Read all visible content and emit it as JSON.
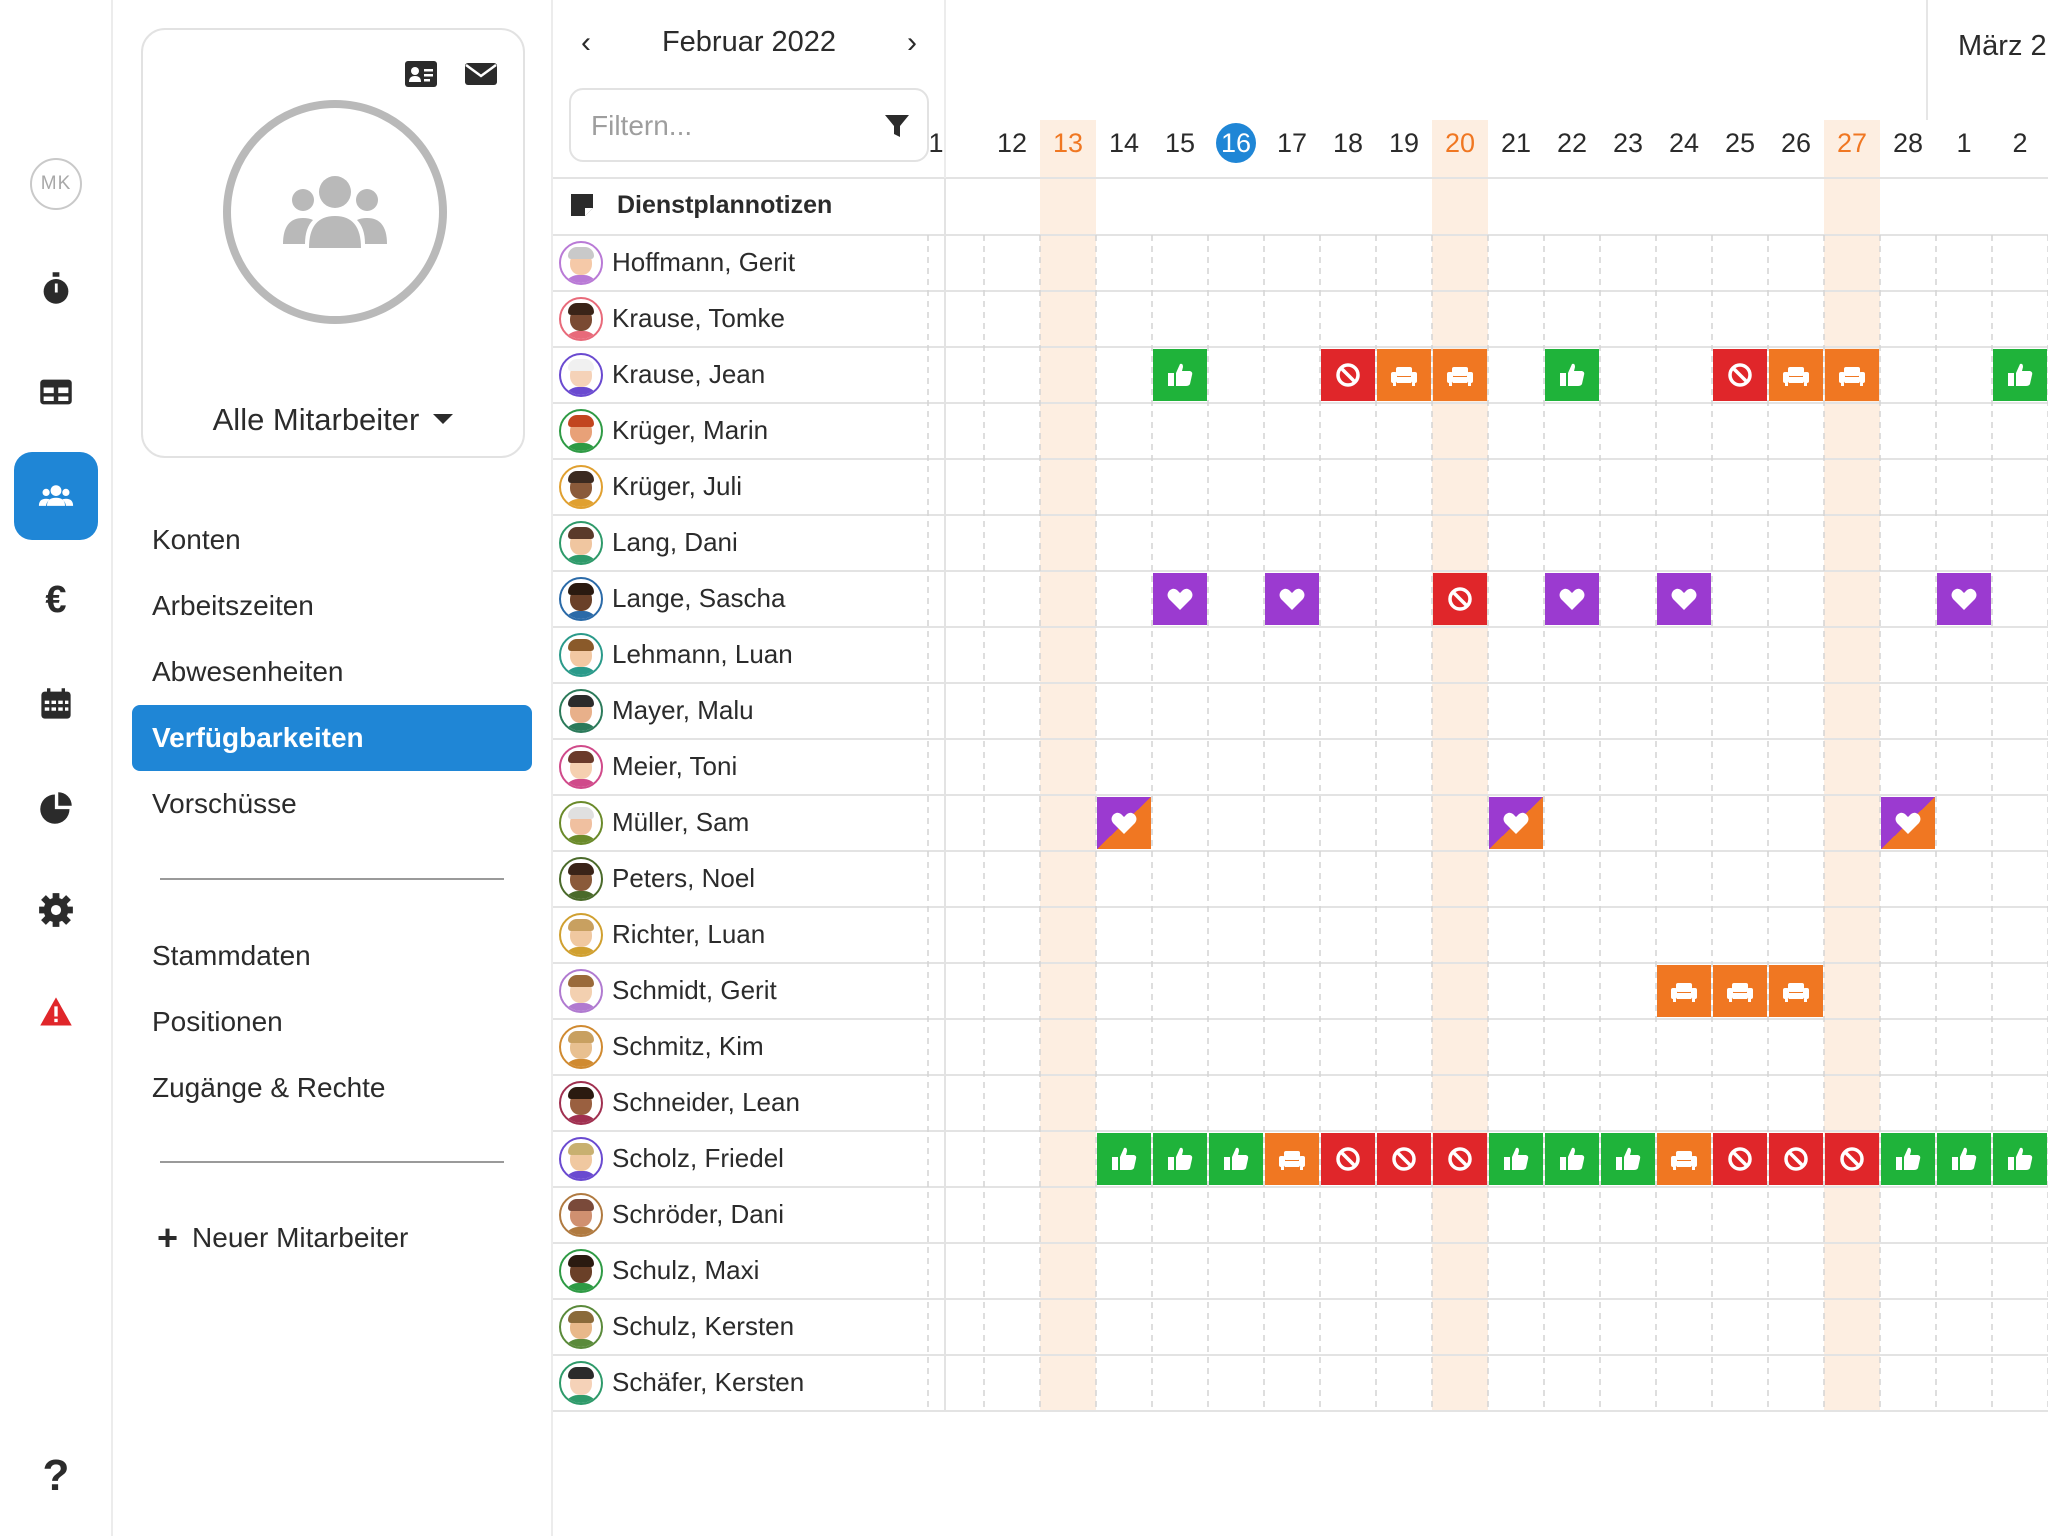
{
  "rail": {
    "user_initials": "MK",
    "items": [
      {
        "name": "timer-icon"
      },
      {
        "name": "table-icon"
      },
      {
        "name": "users-icon",
        "active": true
      },
      {
        "name": "euro-icon",
        "glyph": "€"
      },
      {
        "name": "calendar-icon"
      },
      {
        "name": "pie-chart-icon"
      },
      {
        "name": "gear-icon"
      },
      {
        "name": "warning-icon"
      }
    ],
    "help": "?"
  },
  "panel": {
    "title": "Alle Mitarbeiter",
    "nav_primary": [
      "Konten",
      "Arbeitszeiten",
      "Abwesenheiten",
      "Verfügbarkeiten",
      "Vorschüsse"
    ],
    "active_index": 3,
    "nav_secondary": [
      "Stammdaten",
      "Positionen",
      "Zugänge & Rechte"
    ],
    "new_employee": "Neuer Mitarbeiter"
  },
  "calendar": {
    "month": "Februar 2022",
    "next_month": "März 2",
    "filter_placeholder": "Filtern...",
    "notes_label": "Dienstplannotizen",
    "days": [
      "1",
      "12",
      "13",
      "14",
      "15",
      "16",
      "17",
      "18",
      "19",
      "20",
      "21",
      "22",
      "23",
      "24",
      "25",
      "26",
      "27",
      "28",
      "1",
      "2"
    ],
    "weekend_days": [
      "13",
      "20",
      "27"
    ],
    "today": "16",
    "employees": [
      "Hoffmann, Gerit",
      "Krause, Tomke",
      "Krause, Jean",
      "Krüger, Marin",
      "Krüger, Juli",
      "Lang, Dani",
      "Lange, Sascha",
      "Lehmann, Luan",
      "Mayer, Malu",
      "Meier, Toni",
      "Müller, Sam",
      "Peters, Noel",
      "Richter, Luan",
      "Schmidt, Gerit",
      "Schmitz, Kim",
      "Schneider, Lean",
      "Scholz, Friedel",
      "Schröder, Dani",
      "Schulz, Maxi",
      "Schulz, Kersten",
      "Schäfer, Kersten"
    ],
    "status_colors": {
      "available": "#1fb33a",
      "unavailable": "#e0262a",
      "absence": "#f07722",
      "preferred": "#9b3ad0"
    },
    "entries": [
      {
        "row": 2,
        "day": 4,
        "type": "available"
      },
      {
        "row": 2,
        "day": 7,
        "type": "unavailable"
      },
      {
        "row": 2,
        "day": 8,
        "type": "absence"
      },
      {
        "row": 2,
        "day": 9,
        "type": "absence"
      },
      {
        "row": 2,
        "day": 11,
        "type": "available"
      },
      {
        "row": 2,
        "day": 14,
        "type": "unavailable"
      },
      {
        "row": 2,
        "day": 15,
        "type": "absence"
      },
      {
        "row": 2,
        "day": 16,
        "type": "absence"
      },
      {
        "row": 2,
        "day": 19,
        "type": "available"
      },
      {
        "row": 6,
        "day": 4,
        "type": "preferred"
      },
      {
        "row": 6,
        "day": 6,
        "type": "preferred"
      },
      {
        "row": 6,
        "day": 9,
        "type": "unavailable"
      },
      {
        "row": 6,
        "day": 11,
        "type": "preferred"
      },
      {
        "row": 6,
        "day": 13,
        "type": "preferred"
      },
      {
        "row": 6,
        "day": 18,
        "type": "preferred"
      },
      {
        "row": 10,
        "day": 3,
        "type": "split"
      },
      {
        "row": 10,
        "day": 10,
        "type": "split"
      },
      {
        "row": 10,
        "day": 17,
        "type": "split"
      },
      {
        "row": 13,
        "day": 13,
        "type": "absence"
      },
      {
        "row": 13,
        "day": 14,
        "type": "absence"
      },
      {
        "row": 13,
        "day": 15,
        "type": "absence"
      },
      {
        "row": 16,
        "day": 3,
        "type": "available"
      },
      {
        "row": 16,
        "day": 4,
        "type": "available"
      },
      {
        "row": 16,
        "day": 5,
        "type": "available"
      },
      {
        "row": 16,
        "day": 6,
        "type": "absence"
      },
      {
        "row": 16,
        "day": 7,
        "type": "unavailable"
      },
      {
        "row": 16,
        "day": 8,
        "type": "unavailable"
      },
      {
        "row": 16,
        "day": 9,
        "type": "unavailable"
      },
      {
        "row": 16,
        "day": 10,
        "type": "available"
      },
      {
        "row": 16,
        "day": 11,
        "type": "available"
      },
      {
        "row": 16,
        "day": 12,
        "type": "available"
      },
      {
        "row": 16,
        "day": 13,
        "type": "absence"
      },
      {
        "row": 16,
        "day": 14,
        "type": "unavailable"
      },
      {
        "row": 16,
        "day": 15,
        "type": "unavailable"
      },
      {
        "row": 16,
        "day": 16,
        "type": "unavailable"
      },
      {
        "row": 16,
        "day": 17,
        "type": "available"
      },
      {
        "row": 16,
        "day": 18,
        "type": "available"
      },
      {
        "row": 16,
        "day": 19,
        "type": "available"
      }
    ]
  }
}
